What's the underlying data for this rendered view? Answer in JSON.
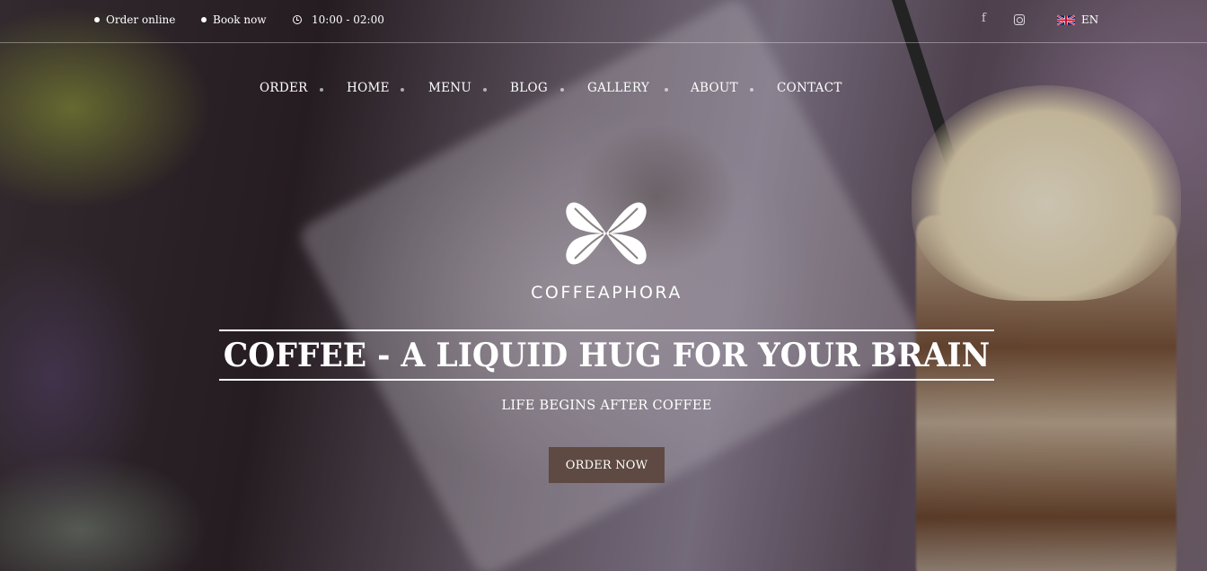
{
  "topbar": {
    "order_online": "Order online",
    "book_now": "Book now",
    "hours": "10:00 - 02:00",
    "facebook_glyph": "f",
    "language": "EN",
    "icons": [
      "dot-icon",
      "clock-icon",
      "facebook-icon",
      "instagram-icon",
      "uk-flag-icon"
    ]
  },
  "nav": {
    "items": [
      "ORDER",
      "HOME",
      "MENU",
      "BLOG",
      "GALLERY",
      "ABOUT",
      "CONTACT"
    ]
  },
  "brand": {
    "name": "COFFEAPHORA"
  },
  "hero": {
    "headline": "COFFEE - A LIQUID HUG FOR YOUR BRAIN",
    "subhead": "LIFE BEGINS AFTER COFFEE",
    "cta_label": "ORDER NOW"
  },
  "colors": {
    "cta_bg": "#5e4a42",
    "text": "#ffffff"
  }
}
